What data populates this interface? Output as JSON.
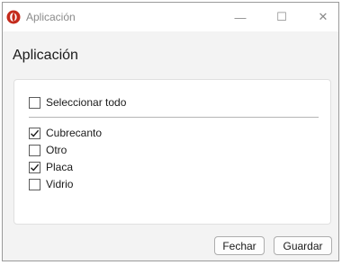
{
  "window": {
    "title": "Aplicación",
    "minimize_glyph": "—",
    "maximize_glyph": "☐",
    "close_glyph": "✕",
    "app_icon": "app-logo-icon",
    "accent_color": "#c42b1c"
  },
  "dialog": {
    "heading": "Aplicación",
    "select_all": {
      "label": "Seleccionar todo",
      "checked": false
    },
    "options": [
      {
        "label": "Cubrecanto",
        "checked": true
      },
      {
        "label": "Otro",
        "checked": false
      },
      {
        "label": "Placa",
        "checked": true
      },
      {
        "label": "Vidrio",
        "checked": false
      }
    ]
  },
  "buttons": {
    "close_label": "Fechar",
    "save_label": "Guardar"
  }
}
